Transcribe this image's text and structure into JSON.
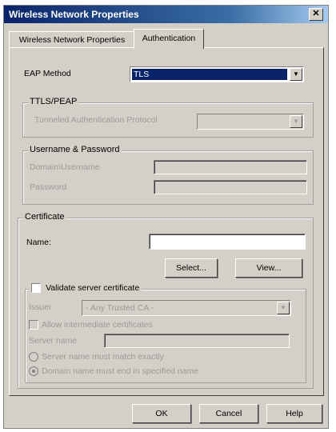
{
  "window": {
    "title": "Wireless Network Properties",
    "close_glyph": "✕"
  },
  "tabs": [
    {
      "label": "Wireless Network Properties",
      "active": false
    },
    {
      "label": "Authentication",
      "active": true
    }
  ],
  "eap": {
    "label": "EAP Method",
    "value": "TLS",
    "arrow": "▼"
  },
  "ttls": {
    "legend": "TTLS/PEAP",
    "label": "Tunneled Authentication Protocol",
    "value": "",
    "arrow": "▼"
  },
  "userpass": {
    "legend": "Username & Password",
    "username_label": "Domain\\Username",
    "password_label": "Password"
  },
  "certificate": {
    "legend": "Certificate",
    "name_label": "Name:",
    "name_value": "",
    "select_button": "Select...",
    "view_button": "View..."
  },
  "validate": {
    "label": "Validate server certificate",
    "issuer_label": "Issuer",
    "issuer_value": "- Any Trusted CA -",
    "intermediate_label": "Allow intermediate certificates",
    "server_name_label": "Server name",
    "radio_exact": "Server name must match exactly",
    "radio_end": "Domain name must end in specified name"
  },
  "buttons": {
    "ok": "OK",
    "cancel": "Cancel",
    "help": "Help"
  }
}
